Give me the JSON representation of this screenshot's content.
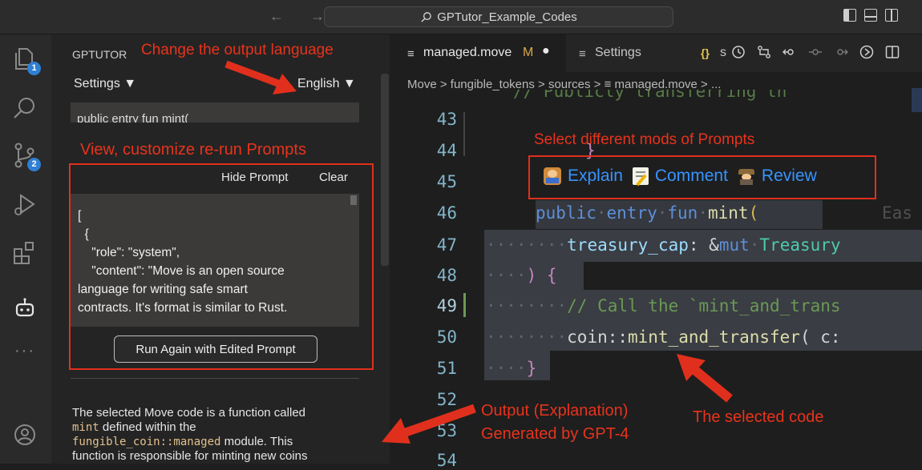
{
  "window": {
    "search_text": "GPTutor_Example_Codes",
    "nav_arrows": "← →"
  },
  "activity_bar": {
    "explorer_badge": "1",
    "scm_badge": "2",
    "more": "···"
  },
  "sidebar": {
    "title": "GPTUTOR",
    "settings_label": "Settings ▼",
    "language_label": "English ▼",
    "prompt_preview": "public entry fun mint(",
    "hide_prompt": "Hide Prompt",
    "clear": "Clear",
    "prompt_lines": [
      "[",
      "  {",
      "    \"role\": \"system\",",
      "    \"content\": \"Move is an open source",
      "language for writing safe smart",
      "contracts. It's format is similar to Rust."
    ],
    "run_again": "Run Again with Edited Prompt",
    "output_line1": "The selected Move code is a function called",
    "output_line2_code": "mint",
    "output_line2_text": " defined within the",
    "output_line3_code": "fungible_coin::managed",
    "output_line3_text": " module. This",
    "output_line4": "function is responsible for minting new coins"
  },
  "editor": {
    "tabs": [
      {
        "icon": "≡",
        "label": "managed.move",
        "status": "M",
        "modified": "●"
      },
      {
        "icon": "≡",
        "label": "Settings"
      },
      {
        "icon": "{}",
        "label": "s"
      }
    ],
    "breadcrumbs": "Move > fungible_tokens > sources > ≡ managed.move > ...",
    "line_numbers": [
      "43",
      "44",
      "45",
      "46",
      "47",
      "48",
      "49",
      "50",
      "51",
      "52",
      "53",
      "54"
    ],
    "top_faded": "// Publicly transferring th",
    "code_lines": {
      "l44": "}",
      "l46_kw1": "public",
      "l46_kw2": "entry",
      "l46_kw3": "fun",
      "l46_fn": "mint",
      "l46_paren": "(",
      "l46_ghost": "Eas",
      "l47_param": "treasury_cap",
      "l47_colon": ": &",
      "l47_mut": "mut",
      "l47_type": "Treasury",
      "l48": ") {",
      "l49": "// Call the `mint_and_trans",
      "l50_ns": "coin::",
      "l50_fn": "mint_and_transfer",
      "l50_rest": "( c:",
      "l51": "}"
    },
    "codelens": {
      "explain": "Explain",
      "comment": "Comment",
      "review": "Review"
    }
  },
  "annotations": {
    "change_lang": "Change the output language",
    "view_prompts": "View, customize re-run Prompts",
    "select_mods": "Select different mods of Prompts",
    "output_line1": "Output (Explanation)",
    "output_line2": "Generated by GPT-4",
    "selected_code": "The selected code"
  },
  "colors": {
    "annotation_red": "#e8331c",
    "keyword_blue": "#5e8fd8",
    "function_yellow": "#dcdcaa",
    "param_teal": "#9cdcfe",
    "comment_green": "#6a9955",
    "codelens_blue": "#3794ff"
  }
}
